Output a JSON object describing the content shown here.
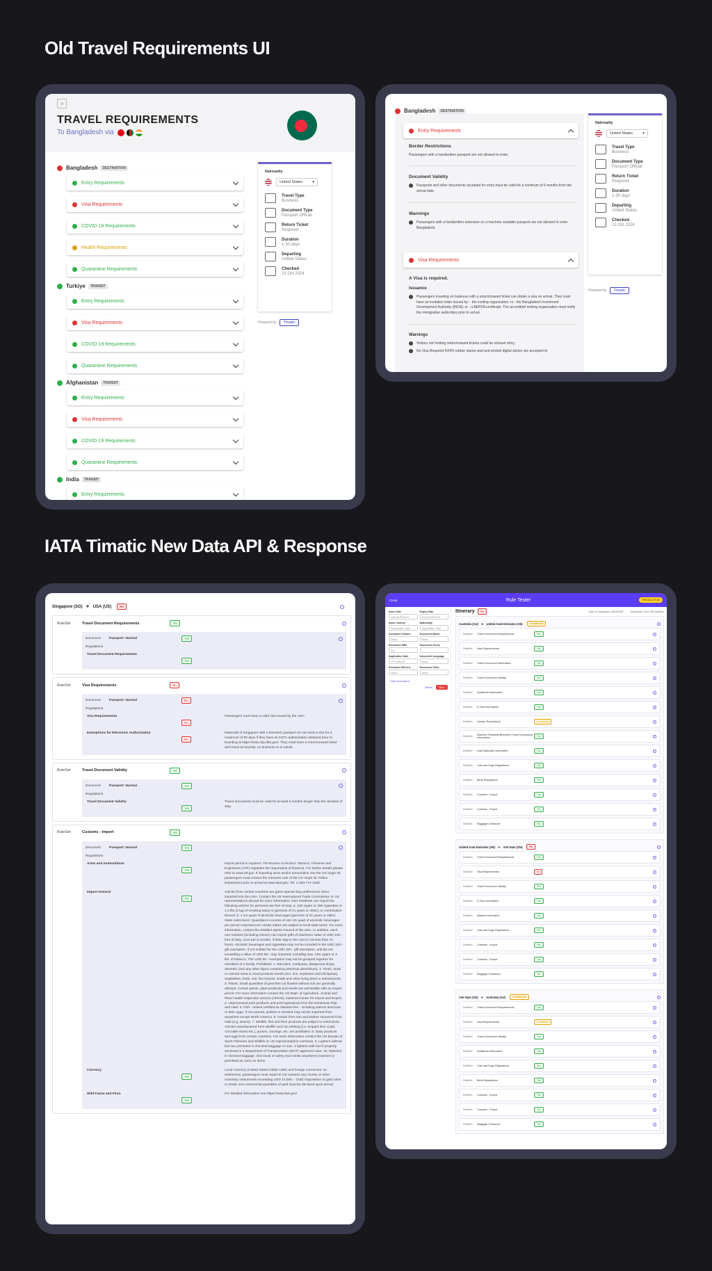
{
  "headings": {
    "old": "Old Travel Requirements UI",
    "new": "IATA Timatic New Data API & Response"
  },
  "old_left": {
    "title": "TRAVEL REQUIREMENTS",
    "subtitle": "To Bangladesh via",
    "groups": [
      {
        "name": "Bangladesh",
        "tag": "DESTINATION",
        "items": [
          "Entry Requirements",
          "Visa Requirements",
          "COVID-19 Requirements",
          "Health Requirements",
          "Quarantine Requirements"
        ]
      },
      {
        "name": "Turkiye",
        "tag": "TRANSIT",
        "items": [
          "Entry Requirements",
          "Visa Requirements",
          "COVID-19 Requirements",
          "Quarantine Requirements"
        ]
      },
      {
        "name": "Afghanistan",
        "tag": "TRANSIT",
        "items": [
          "Entry Requirements",
          "Visa Requirements",
          "COVID-19 Requirements",
          "Quarantine Requirements"
        ]
      },
      {
        "name": "India",
        "tag": "TRANSIT",
        "items": [
          "Entry Requirements"
        ]
      }
    ],
    "sidebar": {
      "nationality_label": "Nationality",
      "nationality_value": "United States",
      "meta": [
        {
          "k": "Travel Type",
          "v": "Business"
        },
        {
          "k": "Document Type",
          "v": "Passport Official"
        },
        {
          "k": "Return Ticket",
          "v": "Required"
        },
        {
          "k": "Duration",
          "v": "1-30 days"
        },
        {
          "k": "Departing",
          "v": "United States"
        },
        {
          "k": "Checked",
          "v": "23 Oct 2024"
        }
      ],
      "powered": "Powered by",
      "brand": "Timatic"
    }
  },
  "old_right": {
    "country": "Bangladesh",
    "tag": "DESTINATION",
    "entry": {
      "label": "Entry Requirements",
      "border_h": "Border Restrictions",
      "border_t": "Passengers with a handwritten passport are not allowed to enter.",
      "validity_h": "Document Validity",
      "validity_t": "Passports and other documents accepted for entry must be valid for a minimum of 6 months from the arrival date.",
      "warn_h": "Warnings",
      "warn_t": "Passengers with a handwritten extension on a machine readable passport are not allowed to enter Bangladesh."
    },
    "visa": {
      "label": "Visa Requirements",
      "required": "A Visa is required.",
      "issuance_h": "Issuance",
      "issuance_t": "Passengers traveling on business with a return/onward ticket can obtain a visa on arrival. They must have an invitation letter issued by: - the inviting organization; or - the Bangladesh Investment Development Authority (BIDA); or - a BEPZA certificate. The accredited inviting organization must notify the immigration authorities prior to arrival.",
      "warn_h": "Warnings",
      "warn1": "Visitors not holding return/onward tickets could be refused entry.",
      "warn2": "No Visa Required (NVR) rubber stamp seal and printed digital sticker are accepted to"
    },
    "sidebar": {
      "nationality_label": "Nationality",
      "nationality_value": "United States",
      "meta": [
        {
          "k": "Travel Type",
          "v": "Business"
        },
        {
          "k": "Document Type",
          "v": "Passport Official"
        },
        {
          "k": "Return Ticket",
          "v": "Required"
        },
        {
          "k": "Duration",
          "v": "1-30 days"
        },
        {
          "k": "Departing",
          "v": "United States"
        },
        {
          "k": "Checked",
          "v": "23 Oct 2024"
        }
      ],
      "powered": "Powered by",
      "brand": "Timatic"
    }
  },
  "new_left": {
    "route_from": "Singapore (SG)",
    "route_to": "USA (US)",
    "route_status": "No",
    "rulesets": [
      {
        "label": "RuleSet",
        "name": "Travel Document Requirements",
        "status": "Yes",
        "doc": "Document",
        "doc_val": "Passport: Normal",
        "reg": "Regulations",
        "rows": [
          {
            "k": "Travel Document Requirements",
            "s": "Yes",
            "t": ""
          }
        ]
      },
      {
        "label": "RuleSet",
        "name": "Visa Requirements",
        "status": "No",
        "doc": "Document",
        "doc_val": "Passport: Normal",
        "reg": "Regulations",
        "rows": [
          {
            "k": "Visa Requirements",
            "s": "No",
            "t": "Passengers must have a valid visa issued by the USA."
          },
          {
            "k": "Exemptions for Electronic Authorization",
            "s": "No",
            "t": "Nationals of Singapore with a biometric passport do not need a visa for a maximum of 90 days if they have an ESTA authorization obtained prior to boarding at https://esta.cbp.dhs.gov/. They must have a return/onward ticket and travel as tourists, on business or in transit."
          }
        ]
      },
      {
        "label": "RuleSet",
        "name": "Travel Document Validity",
        "status": "Yes",
        "doc": "Document",
        "doc_val": "Passport: Normal",
        "reg": "Regulations",
        "rows": [
          {
            "k": "Travel Document Validity",
            "s": "Yes",
            "t": "Travel documents must be valid for at least 6 months longer than the duration of stay."
          }
        ]
      },
      {
        "label": "RuleSet",
        "name": "Customs - Import",
        "status": "Yes",
        "doc": "Document",
        "doc_val": "Passport: Normal",
        "reg": "Regulations",
        "rows": [
          {
            "k": "Arms and Ammunitions",
            "s": "Yes",
            "t": "Import permit is required. The Bureau of Alcohol, Tobacco, Firearms and Explosives (ATF) regulates the importation of firearms. For further details please refer to www.atf.gov. If importing arms and/or ammunition into the US Virgin Isl. passengers must contact the Firearms Unit of the US Virgin Isl. Police Department prior to arrival at www.vipd.gov. Tel: 1-340-774-1525."
          },
          {
            "k": "Import General",
            "s": "Yes",
            "t": "Articles from certain countries are given special duty preferences when imported into the USA. Contact the US International Trade Commission or US representations abroad for more information. Non-residents can import the following articles for personal use free of duty: a. 100 cigars or 200 cigarettes or 4.4 lbs (2 kg) of smoking tobacco (persons of 21 years or older), or combination thereof; b. 1 US quart of alcoholic beverages (persons of 21 years or older). State restrictions: Quantities in excess of one US quart of alcoholic beverages per person imported into certain states are subject to local state taxes. For more information, contact the Distilled Spirits Council of the USA. In addition, each non-resident (including minors) can import gifts of maximum value of USD 100.- free of duty, once per 6 months, if their stay in the USA is not less than 72 hours. Alcoholic beverages and cigarettes may not be included in the USD 100.- gift exemption. If not entitled for the USD 100.- gift exemption, articles not exceeding a value of USD 50.- may imported, including max. 100 cigars or 3 lbs. of tobacco. The USD 50.- exemption may not be grouped together for members of a family. Prohibited: 1. Narcotics, marijuana, dangerous drugs, absinthe (and any other liquor containing artemisia absinthium). 2. Fresh, dried or canned meat or meat products seeds (incl. rice, soybeans and chickpeas), vegetables, fruits, soil, live insects, snails and other living plant or animal pests. 3. Plants. Small quantities of pest-free cut flowers without soil are generally allowed. Certain plants, plant products and seeds are admissible with an import permit. For more information contact the US Dept. of Agriculture, Animal and Plant Health Inspection Service (APHIS), National Center for Import and Export. 4. Unprocessed pork products and pork byproducts from the Dominican Rep. and Haiti. 5. Fish - unless certified as disease-free - including salmon and trout, or their eggs. If not canned, pickled or smoked may not be imported from anywhere except North America. 6. Goods from Iran and leather souvenirs from Haiti (e.g. drums). 7. Wildlife, fish and their products are subject to restrictions. Articles manufactured from wildlife such as clothing (i.e. leopard skin coats, crocodile shoes etc.), purses, carvings, etc. are prohibited. 8. Dairy products and eggs from certain countries. For more information contact the US Bureau of Sport Fisheries and Wildlife or US representations overseas. 9. Lighters without fuel are permitted in checked baggage or max. 2 lighters with fuel if properly enclosed in a Department of Transportation (DOT) approved case. 10. Matches in checked baggage. One book of safety (non-strike anywhere) matches is permitted as carry-on items."
          },
          {
            "k": "Currency",
            "s": "Yes",
            "t": "Local currency (United States Dollar-USD) and foreign currencies: no restrictions, passengers must report to US customs any money or other monetary instruments exceeding USD 10,000.-. Gold: Importation of gold coins or small, non-commercial quantities of gold must be declared upon arrival."
          },
          {
            "k": "Wild Fauna and Flora",
            "s": "Yes",
            "t": "For detailed information see https://www.fws.gov/."
          }
        ]
      }
    ]
  },
  "new_right": {
    "back": "Close",
    "title": "Rule Tester",
    "env": "PRODUCTION",
    "form": [
      {
        "k": "Issue Date",
        "v": "2025-09-08T00:00"
      },
      {
        "k": "Expiry Date",
        "v": "2030-09-08T00:00"
      },
      {
        "k": "Issue Country",
        "v": "Saudi Arabia - SAU"
      },
      {
        "k": "Nationality",
        "v": "Saudi Arabia - SAU"
      },
      {
        "k": "Document Feature",
        "v": "Select"
      },
      {
        "k": "Document Model",
        "v": "Select"
      },
      {
        "k": "Document MRZ",
        "v": "Enr..."
      },
      {
        "k": "Document Series",
        "v": ""
      },
      {
        "k": "Application Date",
        "v": "YYYY-MM-DD"
      },
      {
        "k": "Document Language",
        "v": "Select"
      },
      {
        "k": "Document Record",
        "v": "Select"
      },
      {
        "k": "Document Class",
        "v": "Select"
      }
    ],
    "add_doc": "+ Add Document",
    "reset": "Reset",
    "run": "Run",
    "itinerary": "Itinerary",
    "itin_status": "No",
    "date_txn": "Date of Transaction: 08/09/2025",
    "txn_time": "Transaction Time: 997ms/90ms",
    "legs": [
      {
        "from": "Australia (AU)",
        "to": "United Arab Emirates (AE)",
        "status": "Conditional",
        "status_c": "y",
        "rows": [
          [
            "Travel Document Requirements",
            "Yes"
          ],
          [
            "Visa Requirements",
            "Yes"
          ],
          [
            "Travel Document Information",
            "Yes"
          ],
          [
            "Travel Document Validity",
            "Yes"
          ],
          [
            "Additional Information",
            "Yes"
          ],
          [
            "E-Visa Information",
            "Yes"
          ],
          [
            "Gender Restrictions",
            "Conditional"
          ],
          [
            "Machine Readable/Biometric Travel Documents Information",
            "Yes"
          ],
          [
            "Dual Nationals Information",
            "Yes"
          ],
          [
            "Cats and Dogs Regulations",
            "Yes"
          ],
          [
            "Birds Regulations",
            "Yes"
          ],
          [
            "Customs - Import",
            "Yes"
          ],
          [
            "Customs - Export",
            "Yes"
          ],
          [
            "Baggage Clearance",
            "Yes"
          ]
        ]
      },
      {
        "from": "United Arab Emirates (AE)",
        "to": "Viet Nam (VN)",
        "status": "No",
        "status_c": "r",
        "rows": [
          [
            "Travel Document Requirements",
            "Yes"
          ],
          [
            "Visa Requirements",
            "No"
          ],
          [
            "Travel Document Validity",
            "Yes"
          ],
          [
            "E-Visa Information",
            "Yes"
          ],
          [
            "Malaria Information",
            "Yes"
          ],
          [
            "Cats and Dogs Regulations",
            "Yes"
          ],
          [
            "Customs - Import",
            "Yes"
          ],
          [
            "Customs - Export",
            "Yes"
          ],
          [
            "Baggage Clearance",
            "Yes"
          ]
        ]
      },
      {
        "from": "Viet Nam (VN)",
        "to": "Australia (AU)",
        "status": "Conditional",
        "status_c": "y",
        "rows": [
          [
            "Travel Document Requirements",
            "Yes"
          ],
          [
            "Visa Requirements",
            "Conditional"
          ],
          [
            "Travel Document Validity",
            "Yes"
          ],
          [
            "Additional Information",
            "Yes"
          ],
          [
            "Cats and Dogs Regulations",
            "Yes"
          ],
          [
            "Birds Regulations",
            "Yes"
          ],
          [
            "Customs - Import",
            "Yes"
          ],
          [
            "Customs - Export",
            "Yes"
          ],
          [
            "Baggage Clearance",
            "Yes"
          ]
        ]
      }
    ]
  },
  "colors": {
    "green": "#2fae4b",
    "red": "#d33",
    "orange": "#e0a000",
    "purple": "#5b3df5",
    "timatic": "#3b3ec6",
    "accent": "#6b63c8"
  }
}
